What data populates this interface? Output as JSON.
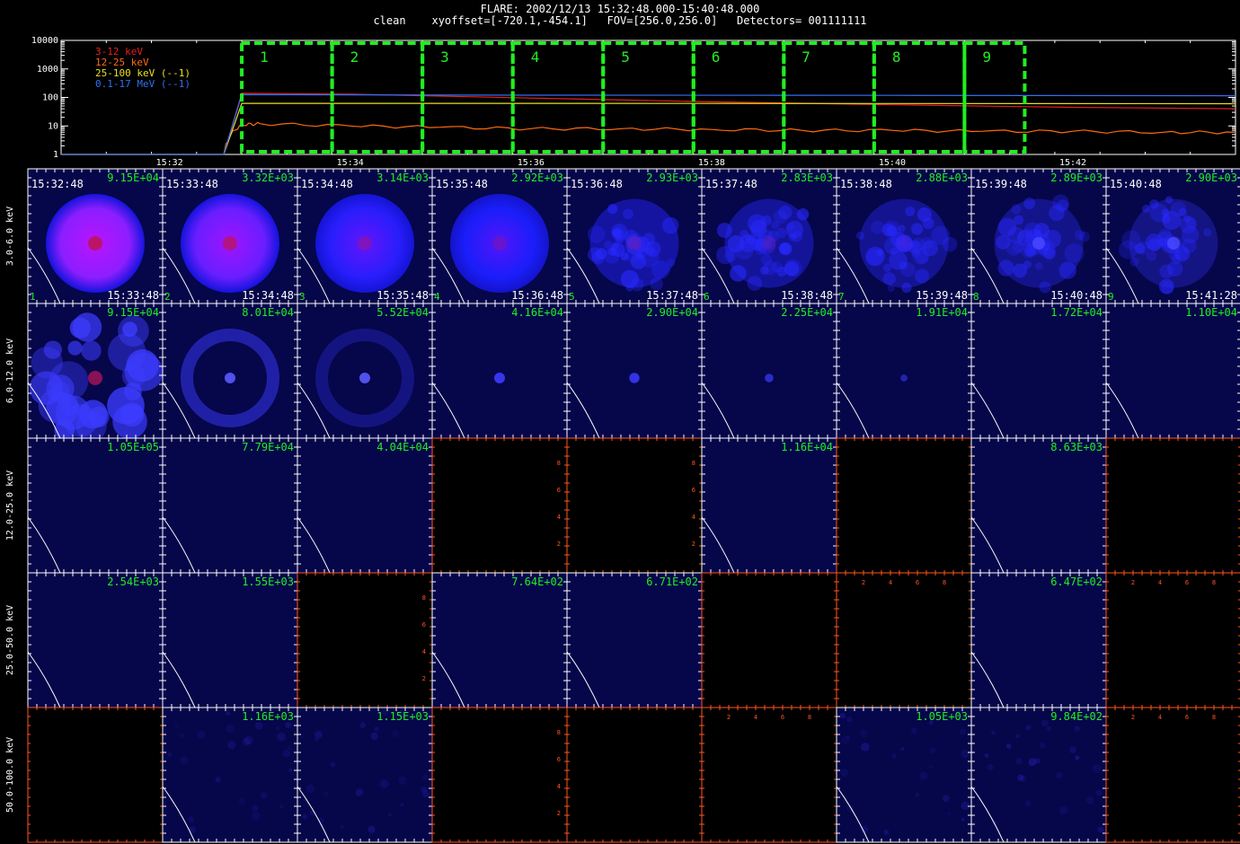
{
  "header": {
    "title": "FLARE: 2002/12/13 15:32:48.000-15:40:48.000",
    "subtitle": "clean    xyoffset=[-720.1,-454.1]   FOV=[256.0,256.0]   Detectors= 001111111"
  },
  "colors": {
    "frame": "#ffffff",
    "interval_box": "#22ee22",
    "label_green": "#22ee22",
    "empty_axis": "#ff5522",
    "image_bg": "#06064a",
    "band_3_12": "#e82020",
    "band_12_25": "#ff6a10",
    "band_25_100": "#e8e020",
    "band_100_17000": "#3070f0"
  },
  "chart_data": [
    {
      "type": "line",
      "ylog": true,
      "ylim": [
        1,
        10000
      ],
      "xlim": [
        "15:30:48",
        "15:43:48"
      ],
      "y_ticks": [
        "10000",
        "1000",
        "100",
        "10",
        "1"
      ],
      "x_ticks": [
        "15:32",
        "15:34",
        "15:36",
        "15:38",
        "15:40",
        "15:42"
      ],
      "legend": [
        "3-12 keV",
        "12-25 keV",
        "25-100 keV (--1)",
        "0.1-17 MeV (--1)"
      ],
      "legend_position": "top-left",
      "intervals": [
        {
          "label": "1",
          "start": "15:32:48",
          "end": "15:33:48"
        },
        {
          "label": "2",
          "start": "15:33:48",
          "end": "15:34:48"
        },
        {
          "label": "3",
          "start": "15:34:48",
          "end": "15:35:48"
        },
        {
          "label": "4",
          "start": "15:35:48",
          "end": "15:36:48"
        },
        {
          "label": "5",
          "start": "15:36:48",
          "end": "15:37:48"
        },
        {
          "label": "6",
          "start": "15:37:48",
          "end": "15:38:48"
        },
        {
          "label": "7",
          "start": "15:38:48",
          "end": "15:39:48"
        },
        {
          "label": "8",
          "start": "15:39:48",
          "end": "15:40:48"
        },
        {
          "label": "9",
          "start": "15:40:48",
          "end": "15:41:28"
        }
      ],
      "series": [
        {
          "name": "3-12 keV",
          "color": "#e82020",
          "x": [
            "15:30:48",
            "15:32:36",
            "15:32:48",
            "15:34",
            "15:36",
            "15:38",
            "15:40",
            "15:42",
            "15:43:48"
          ],
          "y": [
            1,
            1,
            140,
            130,
            95,
            70,
            55,
            45,
            40
          ]
        },
        {
          "name": "12-25 keV",
          "color": "#ff6a10",
          "x": [
            "15:30:48",
            "15:32:36",
            "15:32:48",
            "15:33",
            "15:34",
            "15:35",
            "15:36",
            "15:37",
            "15:38",
            "15:39",
            "15:40",
            "15:41",
            "15:42",
            "15:43",
            "15:43:48"
          ],
          "y": [
            1,
            1,
            11,
            12,
            10,
            9,
            8,
            8,
            7.5,
            7,
            7,
            6.5,
            6.5,
            6,
            6
          ]
        },
        {
          "name": "25-100 keV (--1)",
          "color": "#e8e020",
          "x": [
            "15:30:48",
            "15:32:36",
            "15:32:48",
            "15:36",
            "15:40",
            "15:43:48"
          ],
          "y": [
            1,
            1,
            62,
            62,
            61,
            60
          ]
        },
        {
          "name": "0.1-17 MeV (--1)",
          "color": "#3070f0",
          "x": [
            "15:30:48",
            "15:32:36",
            "15:32:48",
            "15:36",
            "15:40",
            "15:43:48"
          ],
          "y": [
            1,
            1,
            125,
            120,
            118,
            115
          ]
        }
      ]
    },
    {
      "type": "heatmap",
      "row_labels": [
        "3.0-6.0 keV",
        "6.0-12.0 keV",
        "12.0-25.0 keV",
        "25.0-50.0 keV",
        "50.0-100.0 keV"
      ],
      "col_start_times": [
        "15:32:48",
        "15:33:48",
        "15:34:48",
        "15:35:48",
        "15:36:48",
        "15:37:48",
        "15:38:48",
        "15:39:48",
        "15:40:48"
      ],
      "col_end_times": [
        "15:33:48",
        "15:34:48",
        "15:35:48",
        "15:36:48",
        "15:37:48",
        "15:38:48",
        "15:39:48",
        "15:40:48",
        "15:41:28"
      ],
      "col_numbers": [
        "1",
        "2",
        "3",
        "4",
        "5",
        "6",
        "7",
        "8",
        "9"
      ],
      "cells": [
        [
          {
            "max": "9.15E+04",
            "kind": "full",
            "level": 1.0,
            "red": 0.85
          },
          {
            "max": "3.32E+03",
            "kind": "full",
            "level": 1.0,
            "red": 0.7
          },
          {
            "max": "3.14E+03",
            "kind": "full",
            "level": 0.95,
            "red": 0.35
          },
          {
            "max": "2.92E+03",
            "kind": "full",
            "level": 0.9,
            "red": 0.25
          },
          {
            "max": "2.93E+03",
            "kind": "lumpy",
            "level": 0.8,
            "red": 0.25
          },
          {
            "max": "2.83E+03",
            "kind": "lumpy",
            "level": 0.75,
            "red": 0.2
          },
          {
            "max": "2.88E+03",
            "kind": "lumpy",
            "level": 0.7,
            "red": 0.1
          },
          {
            "max": "2.89E+03",
            "kind": "lumpy",
            "level": 0.65,
            "red": 0.05
          },
          {
            "max": "2.90E+03",
            "kind": "lumpy",
            "level": 0.6,
            "red": 0.0
          }
        ],
        [
          {
            "max": "9.15E+04",
            "kind": "blob",
            "level": 1.0,
            "red": 0.5
          },
          {
            "max": "8.01E+04",
            "kind": "ring",
            "level": 0.6,
            "red": 0.0
          },
          {
            "max": "5.52E+04",
            "kind": "ring",
            "level": 0.35,
            "red": 0.0
          },
          {
            "max": "4.16E+04",
            "kind": "dot",
            "level": 0.5,
            "red": 0.0
          },
          {
            "max": "2.90E+04",
            "kind": "dot",
            "level": 0.45,
            "red": 0.0
          },
          {
            "max": "2.25E+04",
            "kind": "dot",
            "level": 0.3,
            "red": 0.0
          },
          {
            "max": "1.91E+04",
            "kind": "dot",
            "level": 0.15,
            "red": 0.0
          },
          {
            "max": "1.72E+04",
            "kind": "plain",
            "level": 0,
            "red": 0
          },
          {
            "max": "1.10E+04",
            "kind": "plain",
            "level": 0,
            "red": 0
          }
        ],
        [
          {
            "max": "1.05E+05",
            "kind": "plain",
            "level": 0,
            "red": 0
          },
          {
            "max": "7.79E+04",
            "kind": "plain",
            "level": 0,
            "red": 0
          },
          {
            "max": "4.04E+04",
            "kind": "plain",
            "level": 0,
            "red": 0
          },
          {
            "max": "",
            "kind": "empty-y",
            "level": 0,
            "red": 0
          },
          {
            "max": "",
            "kind": "empty-y",
            "level": 0,
            "red": 0
          },
          {
            "max": "1.16E+04",
            "kind": "plain",
            "level": 0,
            "red": 0
          },
          {
            "max": "",
            "kind": "empty",
            "level": 0,
            "red": 0
          },
          {
            "max": "8.63E+03",
            "kind": "plain",
            "level": 0,
            "red": 0
          },
          {
            "max": "",
            "kind": "empty",
            "level": 0,
            "red": 0
          }
        ],
        [
          {
            "max": "2.54E+03",
            "kind": "plain",
            "level": 0,
            "red": 0
          },
          {
            "max": "1.55E+03",
            "kind": "plain",
            "level": 0,
            "red": 0
          },
          {
            "max": "",
            "kind": "empty-y",
            "level": 0,
            "red": 0
          },
          {
            "max": "7.64E+02",
            "kind": "plain",
            "level": 0,
            "red": 0
          },
          {
            "max": "6.71E+02",
            "kind": "plain",
            "level": 0,
            "red": 0
          },
          {
            "max": "",
            "kind": "empty",
            "level": 0,
            "red": 0
          },
          {
            "max": "",
            "kind": "empty-x",
            "level": 0,
            "red": 0
          },
          {
            "max": "6.47E+02",
            "kind": "plain",
            "level": 0,
            "red": 0
          },
          {
            "max": "",
            "kind": "empty-x",
            "level": 0,
            "red": 0
          }
        ],
        [
          {
            "max": "",
            "kind": "empty",
            "level": 0,
            "red": 0
          },
          {
            "max": "1.16E+03",
            "kind": "noise",
            "level": 0.2,
            "red": 0
          },
          {
            "max": "1.15E+03",
            "kind": "noise",
            "level": 0.2,
            "red": 0
          },
          {
            "max": "",
            "kind": "empty-y",
            "level": 0,
            "red": 0
          },
          {
            "max": "",
            "kind": "empty",
            "level": 0,
            "red": 0
          },
          {
            "max": "",
            "kind": "empty-x",
            "level": 0,
            "red": 0
          },
          {
            "max": "1.05E+03",
            "kind": "noise",
            "level": 0.25,
            "red": 0
          },
          {
            "max": "9.84E+02",
            "kind": "noise",
            "level": 0.3,
            "red": 0
          },
          {
            "max": "",
            "kind": "empty-x",
            "level": 0,
            "red": 0
          }
        ]
      ],
      "empty_tick_labels": [
        "2",
        "4",
        "6",
        "8"
      ]
    }
  ]
}
